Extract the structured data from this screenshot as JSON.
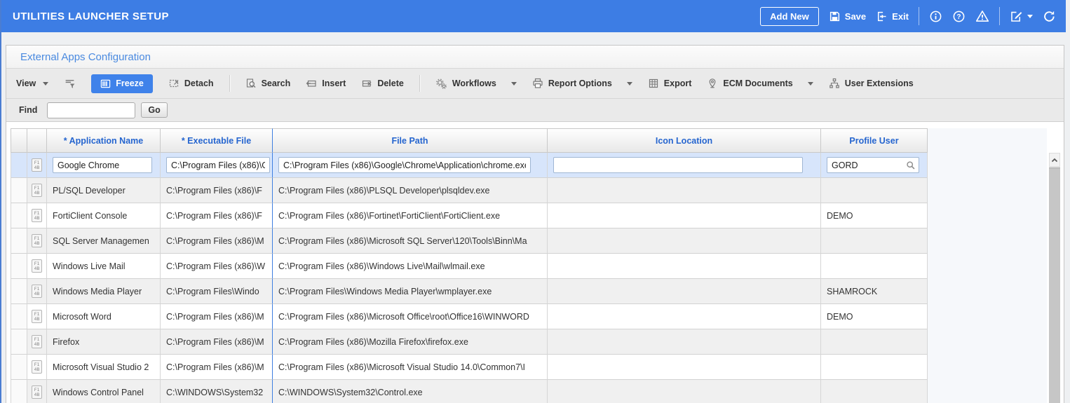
{
  "window": {
    "title": "UTILITIES LAUNCHER SETUP",
    "actions": {
      "add_new": "Add New",
      "save": "Save",
      "exit": "Exit"
    }
  },
  "panel": {
    "title": "External Apps Configuration"
  },
  "toolbar": {
    "view": "View",
    "freeze": "Freeze",
    "detach": "Detach",
    "search": "Search",
    "insert": "Insert",
    "delete": "Delete",
    "workflows": "Workflows",
    "report_options": "Report Options",
    "export": "Export",
    "ecm_documents": "ECM Documents",
    "user_extensions": "User Extensions"
  },
  "find": {
    "label": "Find",
    "value": "",
    "go": "Go"
  },
  "table": {
    "headers": {
      "application_name": "* Application Name",
      "executable_file": "* Executable File",
      "file_path": "File Path",
      "icon_location": "Icon Location",
      "profile_user": "Profile User"
    },
    "rows": [
      {
        "application_name": "Google Chrome",
        "executable_file": "C:\\Program Files (x86)\\G",
        "file_path": "C:\\Program Files (x86)\\Google\\Chrome\\Application\\chrome.exe",
        "icon_location": "",
        "profile_user": "GORD",
        "selected": true,
        "editable": true
      },
      {
        "application_name": "PL/SQL Developer",
        "executable_file": "C:\\Program Files (x86)\\F",
        "file_path": "C:\\Program Files (x86)\\PLSQL Developer\\plsqldev.exe",
        "icon_location": "",
        "profile_user": ""
      },
      {
        "application_name": "FortiClient Console",
        "executable_file": "C:\\Program Files (x86)\\F",
        "file_path": "C:\\Program Files (x86)\\Fortinet\\FortiClient\\FortiClient.exe",
        "icon_location": "",
        "profile_user": "DEMO"
      },
      {
        "application_name": "SQL Server Managemen",
        "executable_file": "C:\\Program Files (x86)\\M",
        "file_path": "C:\\Program Files (x86)\\Microsoft SQL Server\\120\\Tools\\Binn\\Ma",
        "icon_location": "",
        "profile_user": ""
      },
      {
        "application_name": "Windows Live Mail",
        "executable_file": "C:\\Program Files (x86)\\W",
        "file_path": "C:\\Program Files (x86)\\Windows Live\\Mail\\wlmail.exe",
        "icon_location": "",
        "profile_user": ""
      },
      {
        "application_name": "Windows Media Player",
        "executable_file": "C:\\Program Files\\Windo",
        "file_path": "C:\\Program Files\\Windows Media Player\\wmplayer.exe",
        "icon_location": "",
        "profile_user": "SHAMROCK"
      },
      {
        "application_name": "Microsoft Word",
        "executable_file": "C:\\Program Files (x86)\\M",
        "file_path": "C:\\Program Files (x86)\\Microsoft Office\\root\\Office16\\WINWORD",
        "icon_location": "",
        "profile_user": "DEMO"
      },
      {
        "application_name": "Firefox",
        "executable_file": "C:\\Program Files (x86)\\M",
        "file_path": "C:\\Program Files (x86)\\Mozilla Firefox\\firefox.exe",
        "icon_location": "",
        "profile_user": ""
      },
      {
        "application_name": "Microsoft Visual Studio 2",
        "executable_file": "C:\\Program Files (x86)\\M",
        "file_path": "C:\\Program Files (x86)\\Microsoft Visual Studio 14.0\\Common7\\I",
        "icon_location": "",
        "profile_user": ""
      },
      {
        "application_name": "Windows Control Panel",
        "executable_file": "C:\\WINDOWS\\System32",
        "file_path": "C:\\WINDOWS\\System32\\Control.exe",
        "icon_location": "",
        "profile_user": ""
      }
    ]
  },
  "icons": {
    "binary_line1": "F1",
    "binary_line2": "4B",
    "save": "floppy-disk",
    "exit": "exit-arrow",
    "info": "info-circle",
    "help": "question-circle",
    "warning": "warning-triangle",
    "edit": "edit-page",
    "refresh": "refresh-arrows",
    "qbe": "query-filter",
    "freeze": "frozen-columns",
    "detach": "detach-window",
    "search": "magnifier",
    "insert": "insert-row",
    "delete": "delete-row",
    "workflows": "gears",
    "report_options": "printer",
    "export": "export-grid",
    "ecm_documents": "map-pin",
    "user_extensions": "org-chart",
    "profile_lookup": "magnifier",
    "scroll_up": "chevron-up"
  },
  "colors": {
    "titlebar": "#3d7de4",
    "panel_title_text": "#4a8ae0",
    "column_header_text": "#2565cf",
    "selected_row": "#d7e5fb",
    "alt_row": "#f0f0f0",
    "freeze_button": "#3f82ea",
    "freeze_divider": "#3e7fe1"
  }
}
